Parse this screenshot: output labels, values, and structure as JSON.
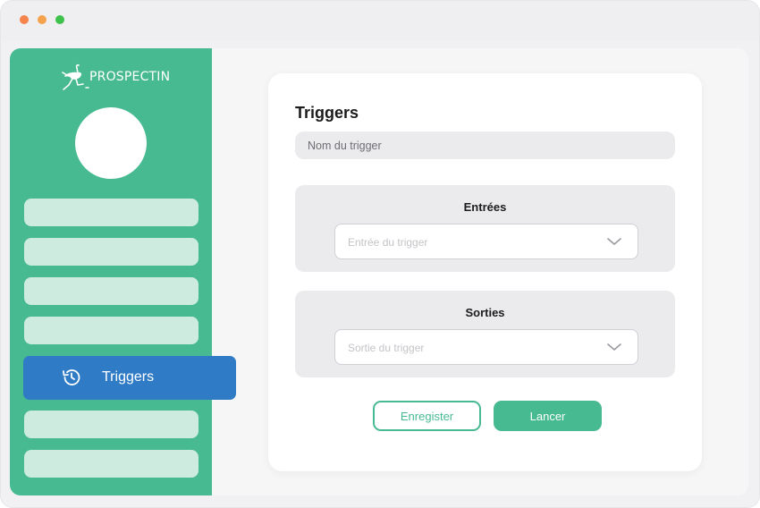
{
  "colors": {
    "sidebar_green": "#47ba92",
    "nav_pill": "#cdebdf",
    "active_blue": "#2f7bc6",
    "dot_red": "#f5844c",
    "dot_yellow": "#f5a24c",
    "dot_green": "#3ec24c",
    "primary_button": "#47ba92",
    "outline_button": "#47ba92"
  },
  "sidebar": {
    "brand": "PROSPECTIN",
    "logo_icon": "ostrich-icon",
    "nav_items": [
      "",
      "",
      "",
      "",
      "",
      ""
    ],
    "active_item": {
      "label": "Triggers",
      "icon": "history-icon"
    }
  },
  "form": {
    "title": "Triggers",
    "name_placeholder": "Nom du trigger",
    "inputs_section": {
      "title": "Entrées",
      "select_placeholder": "Entrée du trigger"
    },
    "outputs_section": {
      "title": "Sorties",
      "select_placeholder": "Sortie du trigger"
    },
    "save_label": "Enregister",
    "run_label": "Lancer"
  }
}
